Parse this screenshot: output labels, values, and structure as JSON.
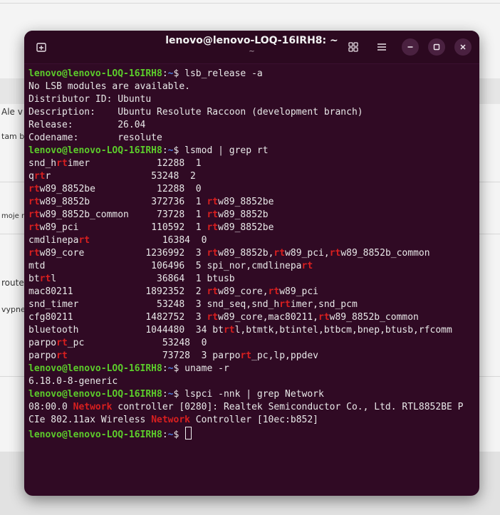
{
  "background": {
    "snippets": [
      "Ale v",
      "tam b",
      "moje m",
      "route",
      "vypne"
    ]
  },
  "window": {
    "title": "lenovo@lenovo-LOQ-16IRH8: ~",
    "subtitle": "~",
    "icons": [
      "new-tab-icon",
      "grid-view-icon",
      "hamburger-menu-icon",
      "minimize-icon",
      "maximize-icon",
      "close-icon"
    ]
  },
  "colors": {
    "terminal_bg": "#300a24",
    "prompt_user": "#5ccc2b",
    "prompt_path": "#4c7ce0",
    "grep_highlight": "#d81f1f"
  },
  "terminal": {
    "lines": [
      {
        "prompt": {
          "user": "lenovo@lenovo-LOQ-16IRH8",
          "sep": ":",
          "path": "~",
          "sym": "$ "
        },
        "segs": [
          {
            "t": "lsb_release -a"
          }
        ]
      },
      {
        "segs": [
          {
            "t": "No LSB modules are available."
          }
        ]
      },
      {
        "segs": [
          {
            "t": "Distributor ID: Ubuntu"
          }
        ]
      },
      {
        "segs": [
          {
            "t": "Description:    Ubuntu Resolute Raccoon (development branch)"
          }
        ]
      },
      {
        "segs": [
          {
            "t": "Release:        26.04"
          }
        ]
      },
      {
        "segs": [
          {
            "t": "Codename:       resolute"
          }
        ]
      },
      {
        "prompt": {
          "user": "lenovo@lenovo-LOQ-16IRH8",
          "sep": ":",
          "path": "~",
          "sym": "$ "
        },
        "segs": [
          {
            "t": "lsmod | grep rt"
          }
        ]
      },
      {
        "segs": [
          {
            "t": "snd_h"
          },
          {
            "t": "rt",
            "h": true
          },
          {
            "t": "imer            12288  1"
          }
        ]
      },
      {
        "segs": [
          {
            "t": "q"
          },
          {
            "t": "rt",
            "h": true
          },
          {
            "t": "r                  53248  2"
          }
        ]
      },
      {
        "segs": [
          {
            "t": "rt",
            "h": true
          },
          {
            "t": "w89_8852be           12288  0"
          }
        ]
      },
      {
        "segs": [
          {
            "t": "rt",
            "h": true
          },
          {
            "t": "w89_8852b           372736  1 "
          },
          {
            "t": "rt",
            "h": true
          },
          {
            "t": "w89_8852be"
          }
        ]
      },
      {
        "segs": [
          {
            "t": "rt",
            "h": true
          },
          {
            "t": "w89_8852b_common     73728  1 "
          },
          {
            "t": "rt",
            "h": true
          },
          {
            "t": "w89_8852b"
          }
        ]
      },
      {
        "segs": [
          {
            "t": "rt",
            "h": true
          },
          {
            "t": "w89_pci             110592  1 "
          },
          {
            "t": "rt",
            "h": true
          },
          {
            "t": "w89_8852be"
          }
        ]
      },
      {
        "segs": [
          {
            "t": "cmdlinepa"
          },
          {
            "t": "rt",
            "h": true
          },
          {
            "t": "             16384  0"
          }
        ]
      },
      {
        "segs": [
          {
            "t": "rt",
            "h": true
          },
          {
            "t": "w89_core           1236992  3 "
          },
          {
            "t": "rt",
            "h": true
          },
          {
            "t": "w89_8852b,"
          },
          {
            "t": "rt",
            "h": true
          },
          {
            "t": "w89_pci,"
          },
          {
            "t": "rt",
            "h": true
          },
          {
            "t": "w89_8852b_common"
          }
        ]
      },
      {
        "segs": [
          {
            "t": "mtd                   106496  5 spi_nor,cmdlinepa"
          },
          {
            "t": "rt",
            "h": true
          }
        ]
      },
      {
        "segs": [
          {
            "t": "bt"
          },
          {
            "t": "rt",
            "h": true
          },
          {
            "t": "l                  36864  1 btusb"
          }
        ]
      },
      {
        "segs": [
          {
            "t": "mac80211             1892352  2 "
          },
          {
            "t": "rt",
            "h": true
          },
          {
            "t": "w89_core,"
          },
          {
            "t": "rt",
            "h": true
          },
          {
            "t": "w89_pci"
          }
        ]
      },
      {
        "segs": [
          {
            "t": "snd_timer              53248  3 snd_seq,snd_h"
          },
          {
            "t": "rt",
            "h": true
          },
          {
            "t": "imer,snd_pcm"
          }
        ]
      },
      {
        "segs": [
          {
            "t": "cfg80211             1482752  3 "
          },
          {
            "t": "rt",
            "h": true
          },
          {
            "t": "w89_core,mac80211,"
          },
          {
            "t": "rt",
            "h": true
          },
          {
            "t": "w89_8852b_common"
          }
        ]
      },
      {
        "segs": [
          {
            "t": "bluetooth            1044480  34 bt"
          },
          {
            "t": "rt",
            "h": true
          },
          {
            "t": "l,btmtk,btintel,btbcm,bnep,btusb,rfcomm"
          }
        ]
      },
      {
        "segs": [
          {
            "t": "parpo"
          },
          {
            "t": "rt",
            "h": true
          },
          {
            "t": "_pc              53248  0"
          }
        ]
      },
      {
        "segs": [
          {
            "t": "parpo"
          },
          {
            "t": "rt",
            "h": true
          },
          {
            "t": "                 73728  3 parpo"
          },
          {
            "t": "rt",
            "h": true
          },
          {
            "t": "_pc,lp,ppdev"
          }
        ]
      },
      {
        "prompt": {
          "user": "lenovo@lenovo-LOQ-16IRH8",
          "sep": ":",
          "path": "~",
          "sym": "$ "
        },
        "segs": [
          {
            "t": "uname -r"
          }
        ]
      },
      {
        "segs": [
          {
            "t": "6.18.0-8-generic"
          }
        ]
      },
      {
        "prompt": {
          "user": "lenovo@lenovo-LOQ-16IRH8",
          "sep": ":",
          "path": "~",
          "sym": "$ "
        },
        "segs": [
          {
            "t": "lspci -nnk | grep Network"
          }
        ]
      },
      {
        "segs": [
          {
            "t": "08:00.0 "
          },
          {
            "t": "Network",
            "h": true
          },
          {
            "t": " controller [0280]: Realtek Semiconductor Co., Ltd. RTL8852BE P"
          }
        ]
      },
      {
        "segs": [
          {
            "t": "CIe 802.11ax Wireless "
          },
          {
            "t": "Network",
            "h": true
          },
          {
            "t": " Controller [10ec:b852]"
          }
        ]
      },
      {
        "prompt": {
          "user": "lenovo@lenovo-LOQ-16IRH8",
          "sep": ":",
          "path": "~",
          "sym": "$ "
        },
        "segs": [],
        "cursor": true
      }
    ]
  }
}
